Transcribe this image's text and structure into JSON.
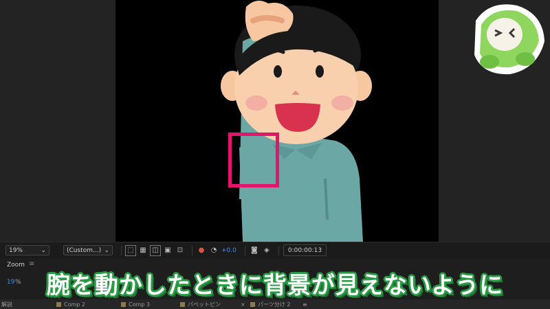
{
  "viewer": {
    "background": "#000000"
  },
  "toolbar": {
    "zoom": "19%",
    "resolution": "(Custom...)",
    "exposure": "+0.0",
    "timecode": "0:00:00:13",
    "icons": [
      "region-of-interest-icon",
      "transparency-grid-icon",
      "mask-outline-icon",
      "guides-icon",
      "3d-view-icon",
      "color-channel-icon",
      "reset-exposure-icon",
      "snapshot-icon",
      "show-snapshot-icon"
    ]
  },
  "panel": {
    "title": "Zoom",
    "menu": "≡",
    "zoom_value": "19",
    "zoom_unit": "%"
  },
  "caption": "腕を動かしたときに背景が見えないように",
  "caption_colors": {
    "fill": "#ffffff",
    "outline": "#2a9a45"
  },
  "tabs": [
    {
      "label": "解説"
    },
    {
      "label": "Comp 2"
    },
    {
      "label": "Comp 3"
    },
    {
      "label": "パペットピン"
    },
    {
      "label": "×"
    },
    {
      "label": "パーツ分け 2"
    },
    {
      "label": "≡"
    }
  ],
  "highlight_color": "#e3166d"
}
